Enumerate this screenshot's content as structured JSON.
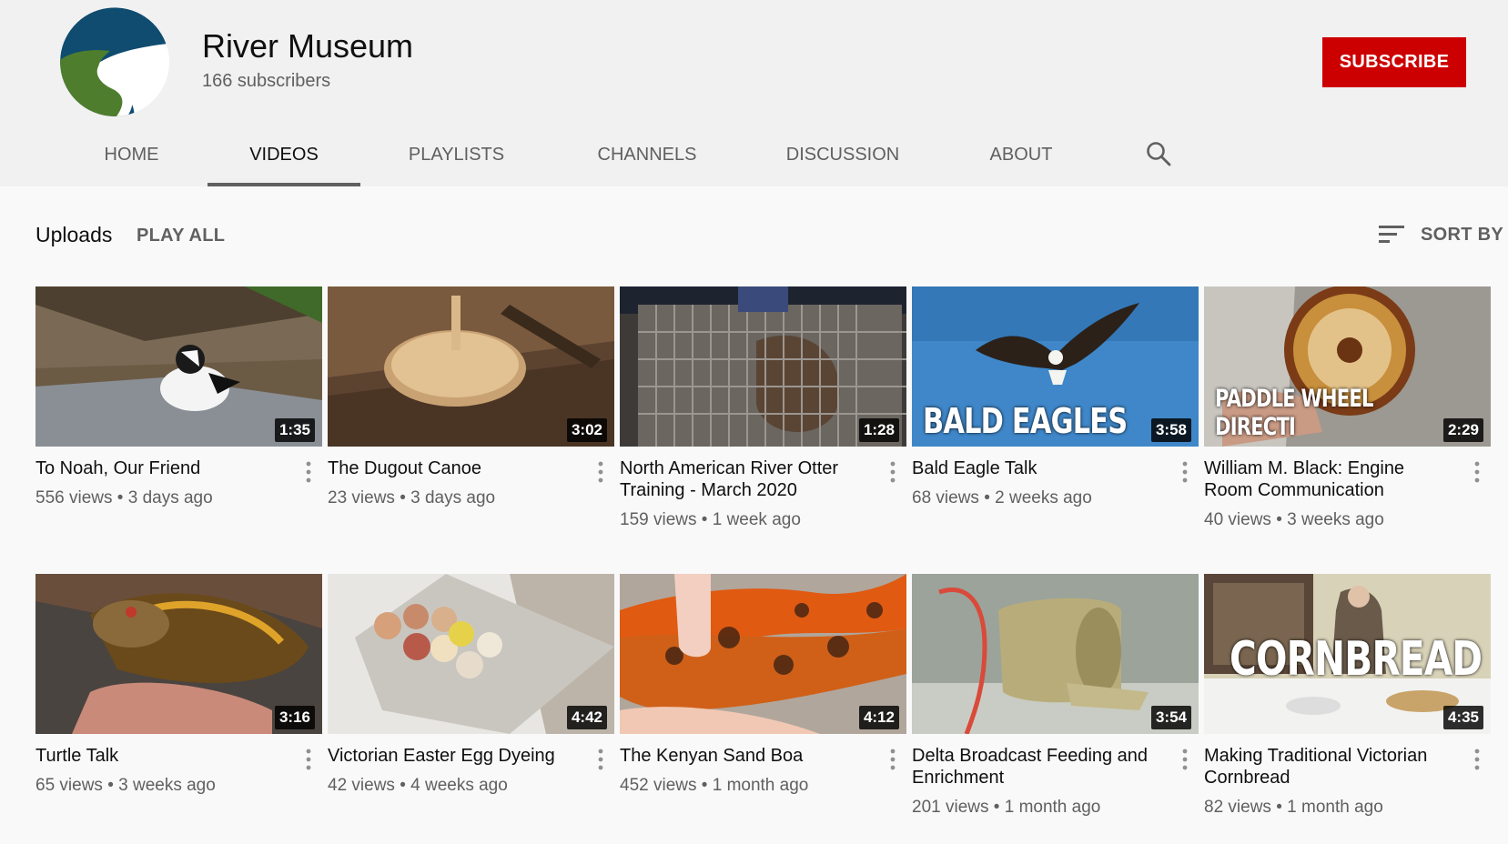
{
  "channel": {
    "name": "River Museum",
    "subscribers": "166 subscribers",
    "subscribe_label": "SUBSCRIBE",
    "logo_colors": {
      "blue": "#0f4c70",
      "green": "#4e7d2e"
    }
  },
  "tabs": [
    {
      "label": "HOME"
    },
    {
      "label": "VIDEOS",
      "active": true
    },
    {
      "label": "PLAYLISTS"
    },
    {
      "label": "CHANNELS"
    },
    {
      "label": "DISCUSSION"
    },
    {
      "label": "ABOUT"
    }
  ],
  "uploads": {
    "title": "Uploads",
    "play_all": "PLAY ALL",
    "sort_label": "SORT BY"
  },
  "videos": [
    {
      "title": "To Noah, Our Friend",
      "views": "556 views",
      "age": "3 days ago",
      "duration": "1:35"
    },
    {
      "title": "The Dugout Canoe",
      "views": "23 views",
      "age": "3 days ago",
      "duration": "3:02"
    },
    {
      "title": "North American River Otter Training - March 2020",
      "views": "159 views",
      "age": "1 week ago",
      "duration": "1:28"
    },
    {
      "title": "Bald Eagle Talk",
      "views": "68 views",
      "age": "2 weeks ago",
      "duration": "3:58",
      "overlay": "BALD EAGLES"
    },
    {
      "title": "William M. Black: Engine Room Communication",
      "views": "40 views",
      "age": "3 weeks ago",
      "duration": "2:29",
      "overlay": "PADDLE WHEEL DIRECTI"
    },
    {
      "title": "Turtle Talk",
      "views": "65 views",
      "age": "3 weeks ago",
      "duration": "3:16"
    },
    {
      "title": "Victorian Easter Egg Dyeing",
      "views": "42 views",
      "age": "4 weeks ago",
      "duration": "4:42"
    },
    {
      "title": "The Kenyan Sand Boa",
      "views": "452 views",
      "age": "1 month ago",
      "duration": "4:12"
    },
    {
      "title": "Delta Broadcast Feeding and Enrichment",
      "views": "201 views",
      "age": "1 month ago",
      "duration": "3:54"
    },
    {
      "title": "Making Traditional Victorian Cornbread",
      "views": "82 views",
      "age": "1 month ago",
      "duration": "4:35",
      "overlay": "CORNBREAD"
    }
  ]
}
